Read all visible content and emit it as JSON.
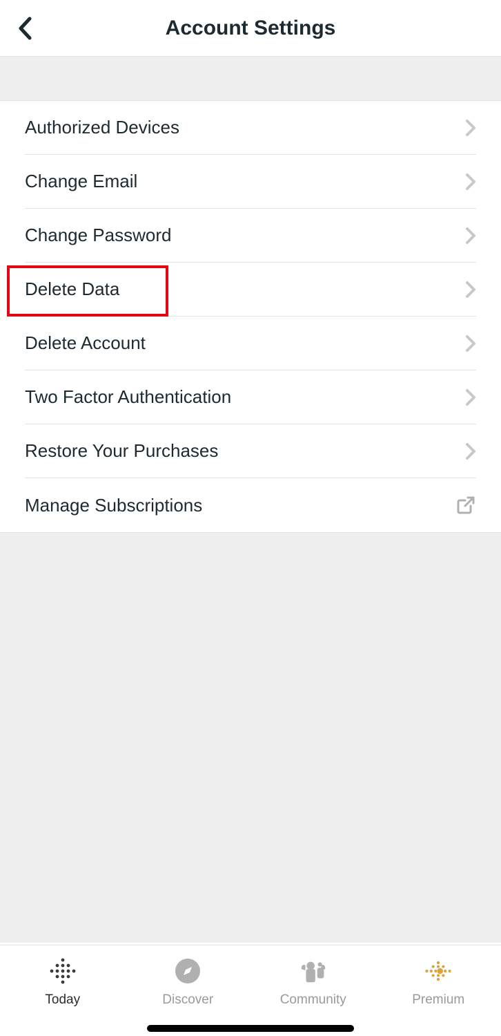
{
  "header": {
    "title": "Account Settings"
  },
  "settings": {
    "items": [
      {
        "label": "Authorized Devices",
        "icon": "chevron"
      },
      {
        "label": "Change Email",
        "icon": "chevron"
      },
      {
        "label": "Change Password",
        "icon": "chevron"
      },
      {
        "label": "Delete Data",
        "icon": "chevron"
      },
      {
        "label": "Delete Account",
        "icon": "chevron"
      },
      {
        "label": "Two Factor Authentication",
        "icon": "chevron"
      },
      {
        "label": "Restore Your Purchases",
        "icon": "chevron"
      },
      {
        "label": "Manage Subscriptions",
        "icon": "external"
      }
    ],
    "highlighted_index": 3
  },
  "tabs": {
    "items": [
      {
        "label": "Today",
        "icon": "today",
        "active": true
      },
      {
        "label": "Discover",
        "icon": "compass",
        "active": false
      },
      {
        "label": "Community",
        "icon": "people",
        "active": false
      },
      {
        "label": "Premium",
        "icon": "premium",
        "active": false
      }
    ]
  }
}
